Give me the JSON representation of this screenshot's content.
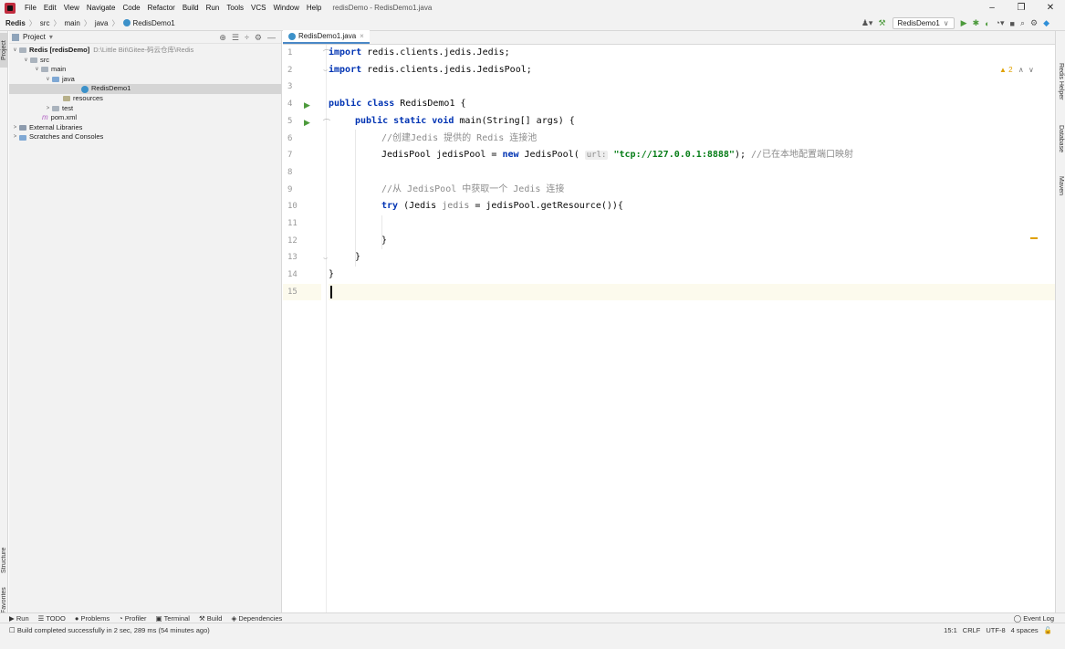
{
  "menubar": {
    "items": [
      "File",
      "Edit",
      "View",
      "Navigate",
      "Code",
      "Refactor",
      "Build",
      "Run",
      "Tools",
      "VCS",
      "Window",
      "Help"
    ],
    "window_title": "redisDemo - RedisDemo1.java",
    "min": "–",
    "max": "❐",
    "close": "✕"
  },
  "navbar": {
    "crumbs": [
      "Redis",
      "src",
      "main",
      "java",
      "RedisDemo1"
    ],
    "run_config": "RedisDemo1",
    "run_config_arrow": "∨"
  },
  "left_strip": {
    "project": "Project",
    "structure": "Structure",
    "favorites": "Favorites"
  },
  "right_strip": {
    "redis_helper": "Redis Helper",
    "database": "Database",
    "maven": "Maven"
  },
  "project_panel": {
    "title": "Project",
    "dropdown": "▾",
    "tree": [
      {
        "label": "Redis [redisDemo]",
        "path": "D:\\Little Bit\\Gitee-码云仓库\\Redis",
        "arrow": "∨"
      },
      {
        "label": "src",
        "arrow": "∨"
      },
      {
        "label": "main",
        "arrow": "∨"
      },
      {
        "label": "java",
        "arrow": "∨"
      },
      {
        "label": "RedisDemo1"
      },
      {
        "label": "resources"
      },
      {
        "label": "test",
        "arrow": ">"
      },
      {
        "label": "pom.xml"
      },
      {
        "label": "External Libraries",
        "arrow": ">"
      },
      {
        "label": "Scratches and Consoles",
        "arrow": ">"
      }
    ]
  },
  "editor": {
    "tab_label": "RedisDemo1.java",
    "tab_close": "×",
    "warnings": "2",
    "lines": [
      "1",
      "2",
      "3",
      "4",
      "5",
      "6",
      "7",
      "8",
      "9",
      "10",
      "11",
      "12",
      "13",
      "14",
      "15"
    ],
    "code": {
      "l1_kw": "import",
      "l1_rest": " redis.clients.jedis.Jedis;",
      "l2_kw": "import",
      "l2_rest": " redis.clients.jedis.JedisPool;",
      "l4_kw": "public class",
      "l4_rest": " RedisDemo1 {",
      "l5_kw": "public static void",
      "l5_rest": " main(String[] args) {",
      "l6_cm": "//创建Jedis 提供的 Redis 连接池",
      "l7_a": "JedisPool jedisPool = ",
      "l7_kw": "new",
      "l7_b": " JedisPool( ",
      "l7_hint": "url:",
      "l7_str": "\"tcp://127.0.0.1:8888\"",
      "l7_c": "); ",
      "l7_cm": "//已在本地配置端口映射",
      "l9_cm": "//从 JedisPool 中获取一个 Jedis 连接",
      "l10_kw": "try",
      "l10_a": " (Jedis ",
      "l10_var": "jedis",
      "l10_b": " = jedisPool.getResource()){",
      "l12": "}",
      "l13": "}",
      "l14": "}"
    }
  },
  "bottom_tools": [
    "Run",
    "TODO",
    "Problems",
    "Profiler",
    "Terminal",
    "Build",
    "Dependencies"
  ],
  "event_log": "Event Log",
  "status": {
    "message": "Build completed successfully in 2 sec, 289 ms (54 minutes ago)",
    "position": "15:1",
    "line_sep": "CRLF",
    "encoding": "UTF-8",
    "indent": "4 spaces"
  }
}
